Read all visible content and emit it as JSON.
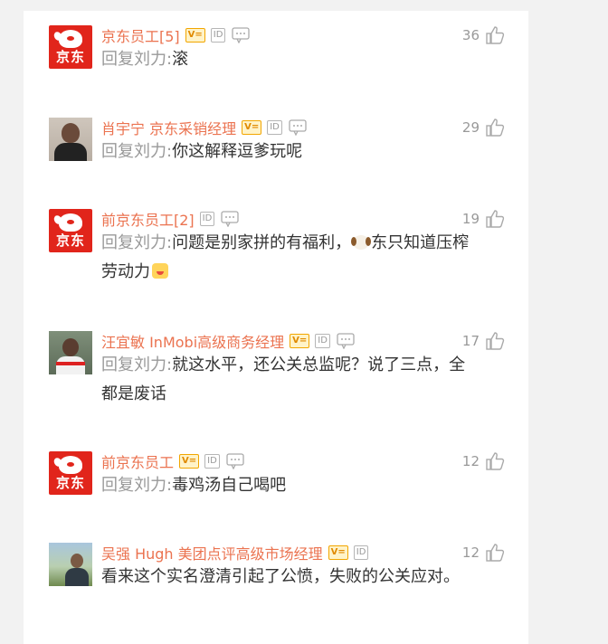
{
  "comments": [
    {
      "username": "京东员工[5]",
      "avatar": "jd-logo",
      "avatar_text": "京东",
      "vip_badge": "V=",
      "id_badge": "ID",
      "has_vip": true,
      "has_msg": true,
      "likes": "36",
      "reply_prefix": "回复刘力:",
      "text": "滚"
    },
    {
      "username": "肖宇宁 京东采销经理",
      "avatar": "photo-man-red-lanyard",
      "vip_badge": "V=",
      "id_badge": "ID",
      "has_vip": true,
      "has_msg": true,
      "likes": "29",
      "reply_prefix": "回复刘力:",
      "text": "你这解释逗爹玩呢"
    },
    {
      "username": "前京东员工[2]",
      "avatar": "jd-logo",
      "avatar_text": "京东",
      "id_badge": "ID",
      "has_vip": false,
      "has_msg": true,
      "likes": "19",
      "reply_prefix": "回复刘力:",
      "text_a": "问题是别家拼的有福利，",
      "emoji_a": "dog-emoji",
      "text_b": "东只知道压榨劳动力",
      "emoji_b": "face-emoji"
    },
    {
      "username": "汪宜敏 InMobi高级商务经理",
      "avatar": "photo-man-jersey",
      "vip_badge": "V=",
      "id_badge": "ID",
      "has_vip": true,
      "has_msg": true,
      "likes": "17",
      "reply_prefix": "回复刘力:",
      "text": "就这水平，还公关总监呢？说了三点，全都是废话"
    },
    {
      "username": "前京东员工",
      "avatar": "jd-logo",
      "avatar_text": "京东",
      "vip_badge": "V=",
      "id_badge": "ID",
      "has_vip": true,
      "has_msg": true,
      "likes": "12",
      "reply_prefix": "回复刘力:",
      "text": "毒鸡汤自己喝吧"
    },
    {
      "username": "吴强 Hugh 美团点评高级市场经理",
      "avatar": "photo-man-outdoor",
      "vip_badge": "V=",
      "id_badge": "ID",
      "has_vip": true,
      "has_msg": false,
      "likes": "12",
      "text": "看来这个实名澄清引起了公愤，失败的公关应对。"
    }
  ],
  "colors": {
    "username": "#eb7350",
    "reply_prefix": "#999999",
    "text": "#333333",
    "jd_red": "#e1251b"
  }
}
